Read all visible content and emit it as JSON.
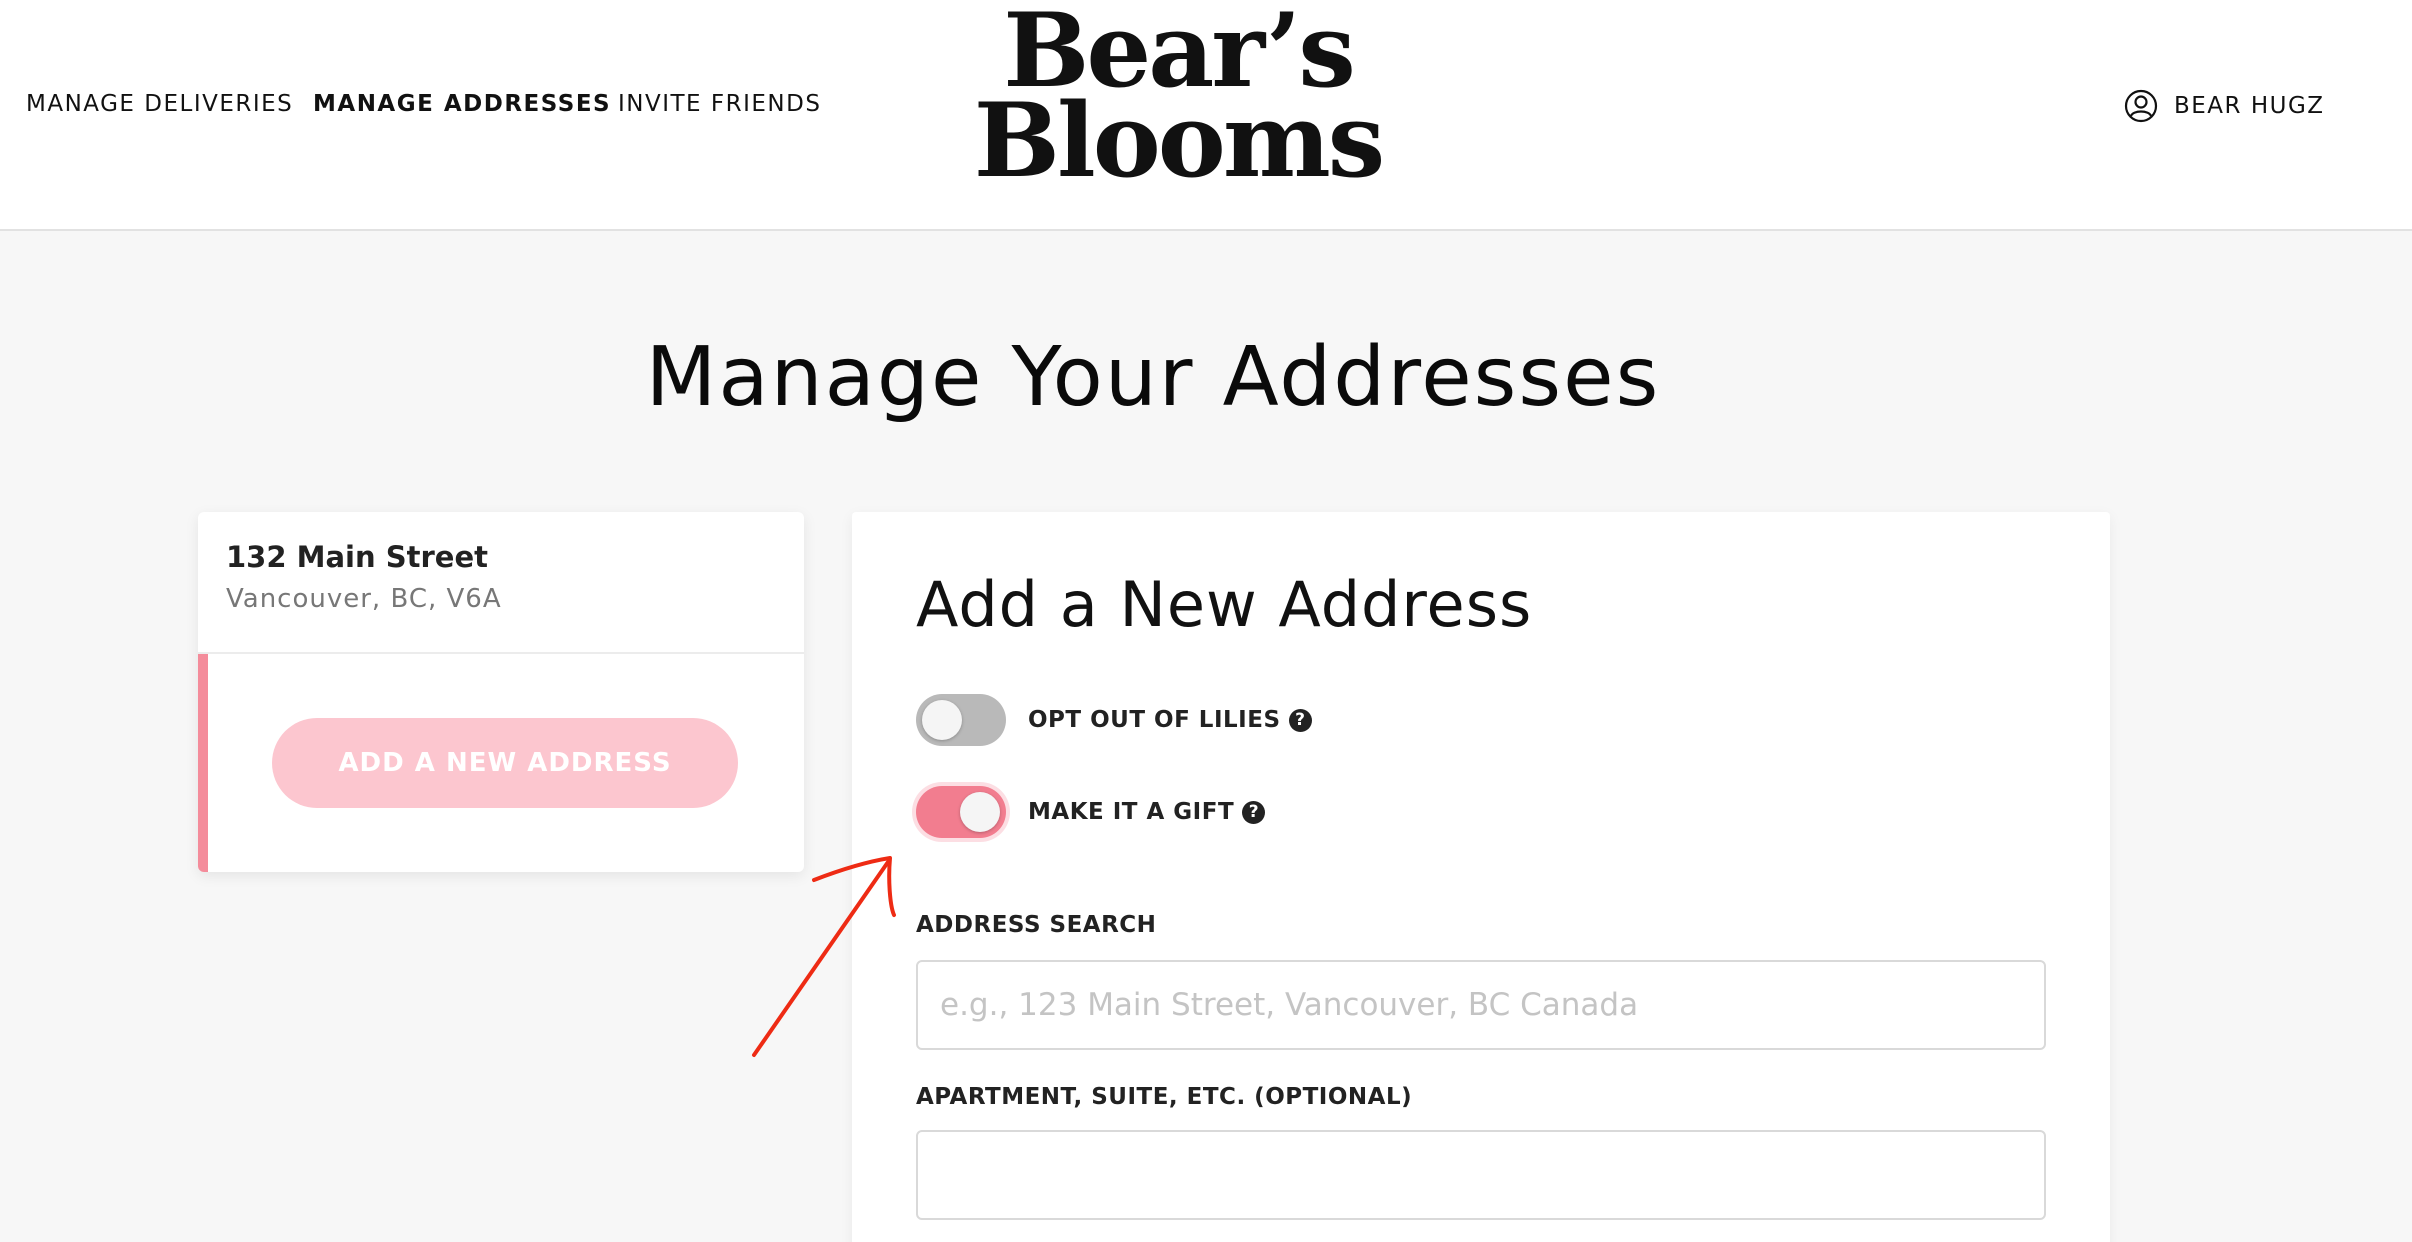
{
  "header": {
    "nav": [
      {
        "label": "MANAGE DELIVERIES"
      },
      {
        "label": "MANAGE ADDRESSES"
      },
      {
        "label": "INVITE FRIENDS"
      }
    ],
    "logo": {
      "line1": "Bear’s",
      "line2": "Blooms"
    },
    "account": {
      "icon": "user-circle-icon",
      "label": "BEAR HUGZ"
    }
  },
  "page": {
    "title": "Manage Your Addresses"
  },
  "addresses": {
    "items": [
      {
        "street": "132 Main Street",
        "city": "Vancouver, BC, V6A"
      }
    ],
    "add_button_label": "ADD A NEW ADDRESS",
    "accent_color": "#f48c9b"
  },
  "form": {
    "title": "Add a New Address",
    "toggles": [
      {
        "label": "OPT OUT OF LILIES",
        "on": false,
        "help_icon": "question-circle-icon"
      },
      {
        "label": "MAKE IT A GIFT",
        "on": true,
        "help_icon": "question-circle-icon"
      }
    ],
    "address_search": {
      "label": "ADDRESS SEARCH",
      "placeholder": "e.g., 123 Main Street, Vancouver, BC Canada",
      "value": ""
    },
    "apartment": {
      "label": "APARTMENT, SUITE, ETC. (OPTIONAL)",
      "placeholder": "",
      "value": ""
    },
    "toggle_on_color": "#f27d8f"
  },
  "annotation": {
    "type": "red-arrow",
    "color": "#ee2b14"
  }
}
